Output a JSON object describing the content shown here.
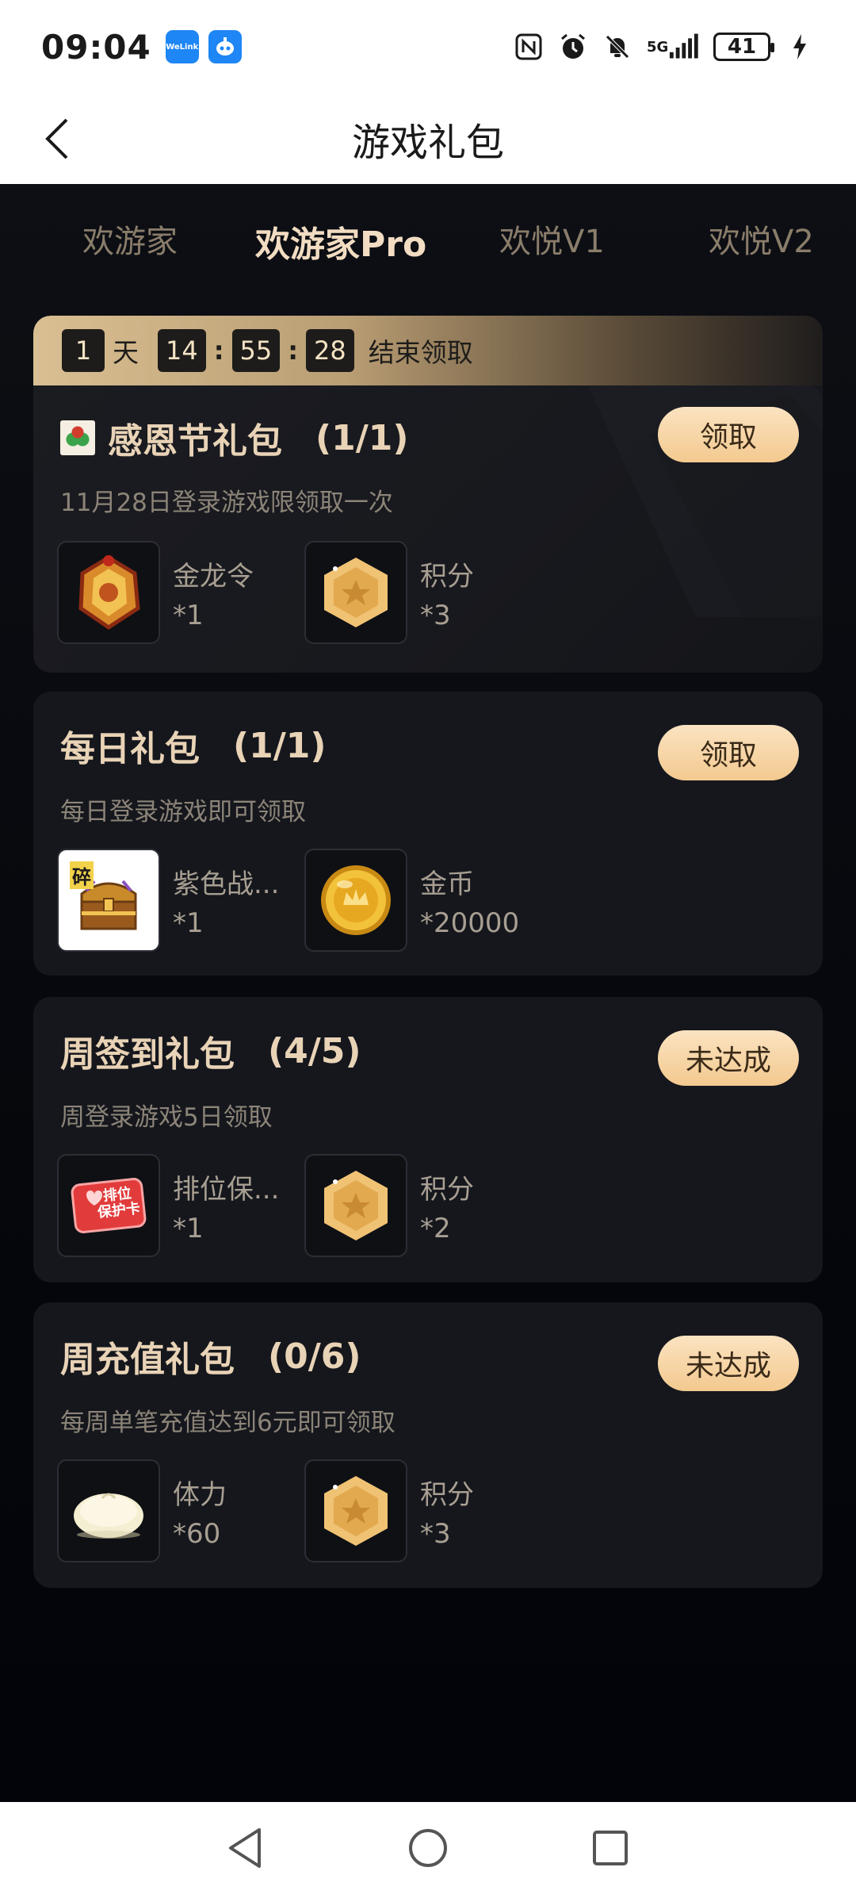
{
  "status_bar": {
    "time": "09:04",
    "apps": [
      "WeLink",
      "robot"
    ],
    "network": "5G",
    "battery": "41"
  },
  "header": {
    "title": "游戏礼包"
  },
  "tabs": [
    {
      "label": "欢游家",
      "active": false
    },
    {
      "label": "欢游家Pro",
      "active": true
    },
    {
      "label": "欢悦V1",
      "active": false
    },
    {
      "label": "欢悦V2",
      "active": false
    }
  ],
  "timer": {
    "days": "1",
    "days_label": "天",
    "hours": "14",
    "minutes": "55",
    "seconds": "28",
    "separator": ":",
    "label": "结束领取"
  },
  "cards": [
    {
      "title": "感恩节礼包",
      "count": "(1/1)",
      "desc": "11月28日登录游戏限领取一次",
      "button": "领取",
      "rewards": [
        {
          "name": "金龙令",
          "qty": "*1",
          "icon": "golden-token-icon"
        },
        {
          "name": "积分",
          "qty": "*3",
          "icon": "points-hexagon-icon"
        }
      ]
    },
    {
      "title": "每日礼包",
      "count": "(1/1)",
      "desc": "每日登录游戏即可领取",
      "button": "领取",
      "rewards": [
        {
          "name": "紫色战...",
          "qty": "*1",
          "icon": "treasure-chest-icon",
          "badge": "碎"
        },
        {
          "name": "金币",
          "qty": "*20000",
          "icon": "gold-coin-icon"
        }
      ]
    },
    {
      "title": "周签到礼包",
      "count": "(4/5)",
      "desc": "周登录游戏5日领取",
      "button": "未达成",
      "rewards": [
        {
          "name": "排位保...",
          "qty": "*1",
          "icon": "rank-protect-card-icon",
          "card_text_1": "排位",
          "card_text_2": "保护卡"
        },
        {
          "name": "积分",
          "qty": "*2",
          "icon": "points-hexagon-icon"
        }
      ]
    },
    {
      "title": "周充值礼包",
      "count": "(0/6)",
      "desc": "每周单笔充值达到6元即可领取",
      "button": "未达成",
      "rewards": [
        {
          "name": "体力",
          "qty": "*60",
          "icon": "steamed-bun-icon"
        },
        {
          "name": "积分",
          "qty": "*3",
          "icon": "points-hexagon-icon"
        }
      ]
    }
  ],
  "colors": {
    "accent": "#f3c98f",
    "title": "#e9d3b6",
    "background": "#06070c"
  }
}
